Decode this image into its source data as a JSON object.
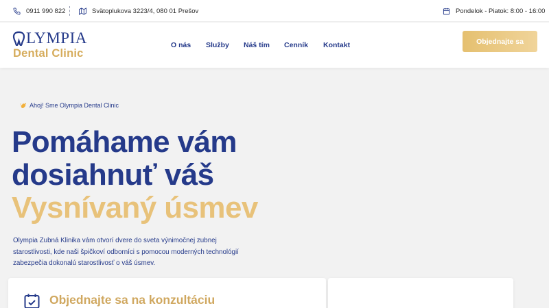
{
  "topbar": {
    "phone": "0911 990 822",
    "address": "Svätoplukova 3223/4, 080 01 Prešov",
    "hours": "Pondelok - Piatok: 8:00 - 16:00"
  },
  "logo": {
    "line1": "LYMPIA",
    "line2": "Dental Clinic"
  },
  "nav": {
    "items": [
      "O nás",
      "Služby",
      "Náš tím",
      "Cenník",
      "Kontakt"
    ]
  },
  "header": {
    "cta_label": "Objednajte sa"
  },
  "hero": {
    "badge": "Ahoj! Sme Olympia Dental Clinic",
    "headline_line1": "Pomáhame vám",
    "headline_line2": "dosiahnuť váš",
    "headline_line3": "Vysnívaný úsmev",
    "description": "Olympia Zubná Klinika vám otvorí dvere do sveta výnimočnej zubnej starostlivosti, kde naši špičkoví odborníci s pomocou moderných technológií zabezpečia dokonalú starostlivosť o váš úsmev."
  },
  "booking": {
    "title": "Objednajte sa na konzultáciu"
  },
  "colors": {
    "brand_blue": "#253a8a",
    "brand_gold": "#e8c27a"
  }
}
